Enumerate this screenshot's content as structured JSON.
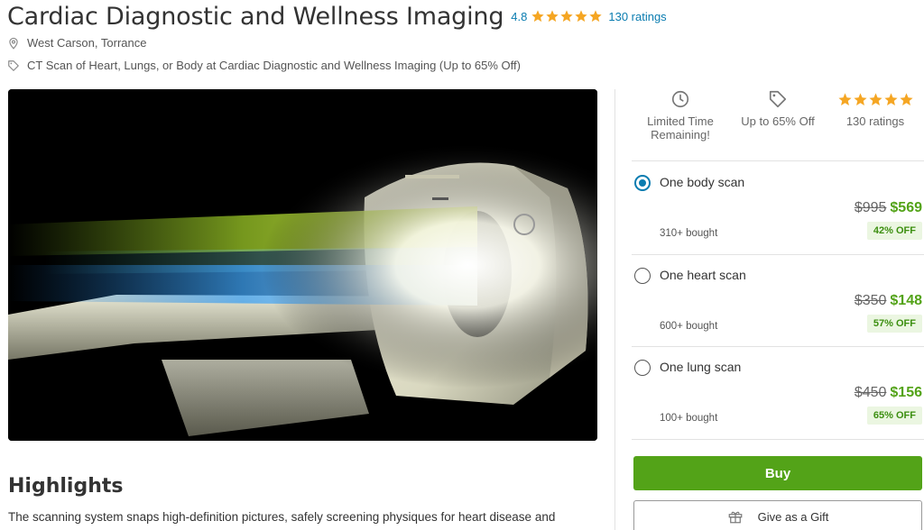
{
  "header": {
    "title": "Cardiac Diagnostic and Wellness Imaging",
    "rating_value": "4.8",
    "rating_stars": 5,
    "rating_count": "130 ratings"
  },
  "location": {
    "icon": "location-pin-icon",
    "text": "West Carson, Torrance"
  },
  "deal": {
    "icon": "tag-icon",
    "text": "CT Scan of Heart, Lungs, or Body at Cardiac Diagnostic and Wellness Imaging (Up to 65% Off)"
  },
  "hero_image": {
    "subject": "ct-scanner-image"
  },
  "highlights": {
    "title": "Highlights",
    "text": "The scanning system snaps high-definition pictures, safely screening physiques for heart disease and"
  },
  "features": [
    {
      "icon": "clock-icon",
      "label": "Limited Time Remaining!"
    },
    {
      "icon": "tag-icon",
      "label": "Up to 65% Off"
    },
    {
      "icon": "stars-icon",
      "label": "130 ratings"
    }
  ],
  "options": [
    {
      "label": "One body scan",
      "original_price": "$995",
      "sale_price": "$569",
      "bought": "310+ bought",
      "discount": "42% OFF",
      "selected": true
    },
    {
      "label": "One heart scan",
      "original_price": "$350",
      "sale_price": "$148",
      "bought": "600+ bought",
      "discount": "57% OFF",
      "selected": false
    },
    {
      "label": "One lung scan",
      "original_price": "$450",
      "sale_price": "$156",
      "bought": "100+ bought",
      "discount": "65% OFF",
      "selected": false
    }
  ],
  "actions": {
    "buy_label": "Buy",
    "gift_label": "Give as a Gift",
    "gift_icon": "gift-icon"
  },
  "colors": {
    "link": "#0a7cb0",
    "star": "#f5a623",
    "buy_green": "#53a318",
    "discount_bg": "#ebf6e1"
  }
}
